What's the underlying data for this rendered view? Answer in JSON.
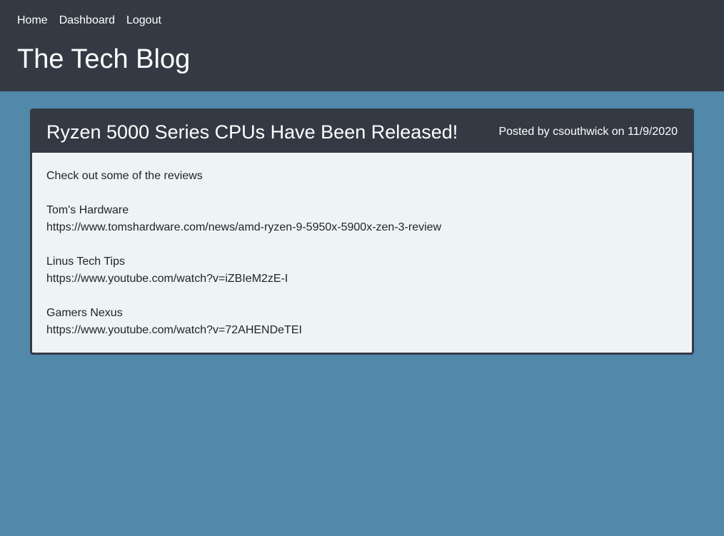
{
  "nav": {
    "home": "Home",
    "dashboard": "Dashboard",
    "logout": "Logout"
  },
  "site": {
    "title": "The Tech Blog"
  },
  "post": {
    "title": "Ryzen 5000 Series CPUs Have Been Released!",
    "meta": "Posted by csouthwick on 11/9/2020",
    "lines": [
      "Check out some of the reviews",
      "",
      "Tom's Hardware",
      "https://www.tomshardware.com/news/amd-ryzen-9-5950x-5900x-zen-3-review",
      "",
      "Linus Tech Tips",
      "https://www.youtube.com/watch?v=iZBIeM2zE-I",
      "",
      "Gamers Nexus",
      "https://www.youtube.com/watch?v=72AHENDeTEI"
    ]
  },
  "colors": {
    "header_bg": "#343a44",
    "page_bg": "#5288a9",
    "card_body_bg": "#eef3f6"
  }
}
